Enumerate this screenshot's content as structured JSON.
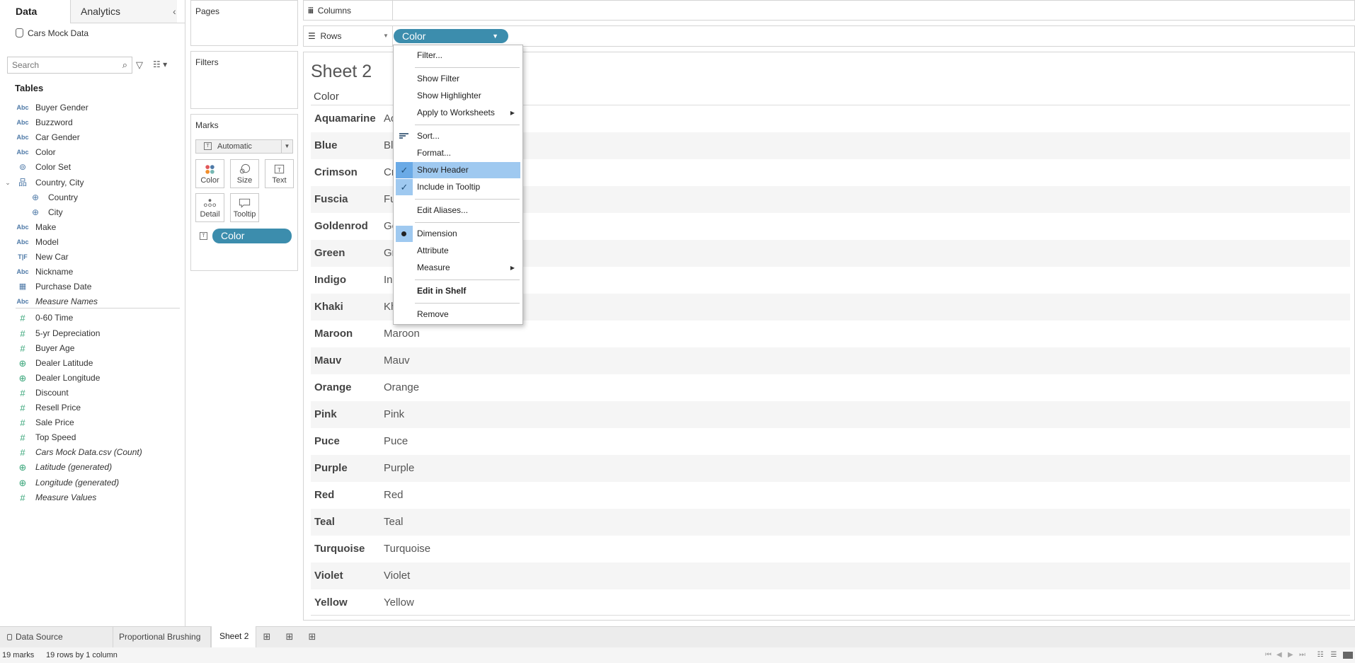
{
  "left_pane": {
    "tabs": [
      "Data",
      "Analytics"
    ],
    "data_source": "Cars Mock Data",
    "search_placeholder": "Search",
    "tables_heading": "Tables",
    "fields": [
      {
        "icon": "Abc",
        "type": "abc",
        "label": "Buyer Gender",
        "indent": 0,
        "italic": false
      },
      {
        "icon": "Abc",
        "type": "abc",
        "label": "Buzzword",
        "indent": 0,
        "italic": false
      },
      {
        "icon": "Abc",
        "type": "abc",
        "label": "Car Gender",
        "indent": 0,
        "italic": false
      },
      {
        "icon": "Abc",
        "type": "abc",
        "label": "Color",
        "indent": 0,
        "italic": false
      },
      {
        "icon": "⊚",
        "type": "set",
        "label": "Color Set",
        "indent": 0,
        "italic": false
      },
      {
        "icon": "品",
        "type": "hier",
        "label": "Country, City",
        "indent": 0,
        "italic": false
      },
      {
        "icon": "⊕",
        "type": "geo",
        "label": "Country",
        "indent": 1,
        "italic": false
      },
      {
        "icon": "⊕",
        "type": "geo",
        "label": "City",
        "indent": 1,
        "italic": false
      },
      {
        "icon": "Abc",
        "type": "abc",
        "label": "Make",
        "indent": 0,
        "italic": false
      },
      {
        "icon": "Abc",
        "type": "abc",
        "label": "Model",
        "indent": 0,
        "italic": false
      },
      {
        "icon": "T|F",
        "type": "tf",
        "label": "New Car",
        "indent": 0,
        "italic": false
      },
      {
        "icon": "Abc",
        "type": "abc",
        "label": "Nickname",
        "indent": 0,
        "italic": false
      },
      {
        "icon": "▦",
        "type": "cal",
        "label": "Purchase Date",
        "indent": 0,
        "italic": false
      },
      {
        "icon": "Abc",
        "type": "abc",
        "label": "Measure Names",
        "indent": 0,
        "italic": true
      },
      {
        "icon": "#",
        "type": "num",
        "label": "0-60 Time",
        "indent": 0,
        "italic": false
      },
      {
        "icon": "#",
        "type": "num",
        "label": "5-yr Depreciation",
        "indent": 0,
        "italic": false
      },
      {
        "icon": "#",
        "type": "num",
        "label": "Buyer Age",
        "indent": 0,
        "italic": false
      },
      {
        "icon": "⊕",
        "type": "geo-num",
        "label": "Dealer Latitude",
        "indent": 0,
        "italic": false
      },
      {
        "icon": "⊕",
        "type": "geo-num",
        "label": "Dealer Longitude",
        "indent": 0,
        "italic": false
      },
      {
        "icon": "#",
        "type": "num",
        "label": "Discount",
        "indent": 0,
        "italic": false
      },
      {
        "icon": "#",
        "type": "num",
        "label": "Resell Price",
        "indent": 0,
        "italic": false
      },
      {
        "icon": "#",
        "type": "num",
        "label": "Sale Price",
        "indent": 0,
        "italic": false
      },
      {
        "icon": "#",
        "type": "num",
        "label": "Top Speed",
        "indent": 0,
        "italic": false
      },
      {
        "icon": "#",
        "type": "num",
        "label": "Cars Mock Data.csv (Count)",
        "indent": 0,
        "italic": true
      },
      {
        "icon": "⊕",
        "type": "geo-num",
        "label": "Latitude (generated)",
        "indent": 0,
        "italic": true
      },
      {
        "icon": "⊕",
        "type": "geo-num",
        "label": "Longitude (generated)",
        "indent": 0,
        "italic": true
      },
      {
        "icon": "#",
        "type": "num",
        "label": "Measure Values",
        "indent": 0,
        "italic": true
      }
    ]
  },
  "cards": {
    "pages": "Pages",
    "filters": "Filters",
    "marks": "Marks",
    "mark_type": "Automatic",
    "mark_buttons": [
      "Color",
      "Size",
      "Text",
      "Detail",
      "Tooltip"
    ],
    "marks_pill": "Color"
  },
  "shelves": {
    "columns": "Columns",
    "rows": "Rows",
    "rows_pill": "Color"
  },
  "sheet": {
    "title": "Sheet 2",
    "column_header": "Color",
    "rows": [
      {
        "header": "Aquamarine",
        "value": "Ac"
      },
      {
        "header": "Blue",
        "value": "Bl"
      },
      {
        "header": "Crimson",
        "value": "Cr"
      },
      {
        "header": "Fuscia",
        "value": "Fu"
      },
      {
        "header": "Goldenrod",
        "value": "Go"
      },
      {
        "header": "Green",
        "value": "Gr"
      },
      {
        "header": "Indigo",
        "value": "In"
      },
      {
        "header": "Khaki",
        "value": "Kh"
      },
      {
        "header": "Maroon",
        "value": "Maroon"
      },
      {
        "header": "Mauv",
        "value": "Mauv"
      },
      {
        "header": "Orange",
        "value": "Orange"
      },
      {
        "header": "Pink",
        "value": "Pink"
      },
      {
        "header": "Puce",
        "value": "Puce"
      },
      {
        "header": "Purple",
        "value": "Purple"
      },
      {
        "header": "Red",
        "value": "Red"
      },
      {
        "header": "Teal",
        "value": "Teal"
      },
      {
        "header": "Turquoise",
        "value": "Turquoise"
      },
      {
        "header": "Violet",
        "value": "Violet"
      },
      {
        "header": "Yellow",
        "value": "Yellow"
      }
    ]
  },
  "context_menu": {
    "items": [
      {
        "label": "Filter...",
        "kind": "plain"
      },
      {
        "kind": "sep"
      },
      {
        "label": "Show Filter",
        "kind": "plain"
      },
      {
        "label": "Show Highlighter",
        "kind": "plain"
      },
      {
        "label": "Apply to Worksheets",
        "kind": "submenu"
      },
      {
        "kind": "sep"
      },
      {
        "label": "Sort...",
        "kind": "sort"
      },
      {
        "label": "Format...",
        "kind": "plain"
      },
      {
        "label": "Show Header",
        "kind": "check",
        "highlighted": true
      },
      {
        "label": "Include in Tooltip",
        "kind": "check"
      },
      {
        "kind": "sep"
      },
      {
        "label": "Edit Aliases...",
        "kind": "plain"
      },
      {
        "kind": "sep"
      },
      {
        "label": "Dimension",
        "kind": "radio"
      },
      {
        "label": "Attribute",
        "kind": "plain"
      },
      {
        "label": "Measure",
        "kind": "submenu"
      },
      {
        "kind": "sep"
      },
      {
        "label": "Edit in Shelf",
        "kind": "bold"
      },
      {
        "kind": "sep"
      },
      {
        "label": "Remove",
        "kind": "plain"
      }
    ]
  },
  "bottom_tabs": {
    "data_source": "Data Source",
    "tabs": [
      "Proportional Brushing",
      "Sheet 2"
    ]
  },
  "status": {
    "marks": "19 marks",
    "rows": "19 rows by 1 column"
  },
  "colors": {
    "pill": "#3c8dad",
    "menu_highlight": "#9fc9f0",
    "number_icon": "#3aa67a",
    "dimension_icon": "#4e79a7"
  }
}
